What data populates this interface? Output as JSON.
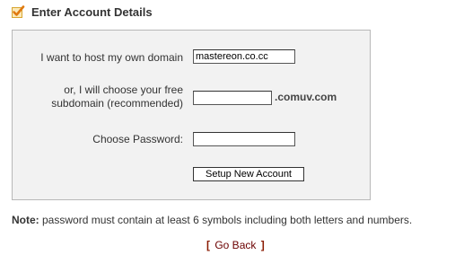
{
  "header": {
    "title": "Enter Account Details",
    "icon": "checkmark-icon",
    "icon_colors": {
      "box": "#d8a530",
      "check": "#e07a10"
    }
  },
  "form": {
    "domain_label": "I want to host my own domain",
    "domain_value": "mastereon.co.cc",
    "subdomain_label_line1": "or, I will choose your free",
    "subdomain_label_line2": "subdomain (recommended)",
    "subdomain_value": "",
    "subdomain_suffix": ".comuv.com",
    "password_label": "Choose Password:",
    "password_value": "",
    "submit_label": "Setup New Account"
  },
  "note": {
    "label": "Note:",
    "text": " password must contain at least 6 symbols including both letters and numbers."
  },
  "footer": {
    "open_bracket": "[",
    "link_label": "Go Back",
    "close_bracket": "]"
  }
}
